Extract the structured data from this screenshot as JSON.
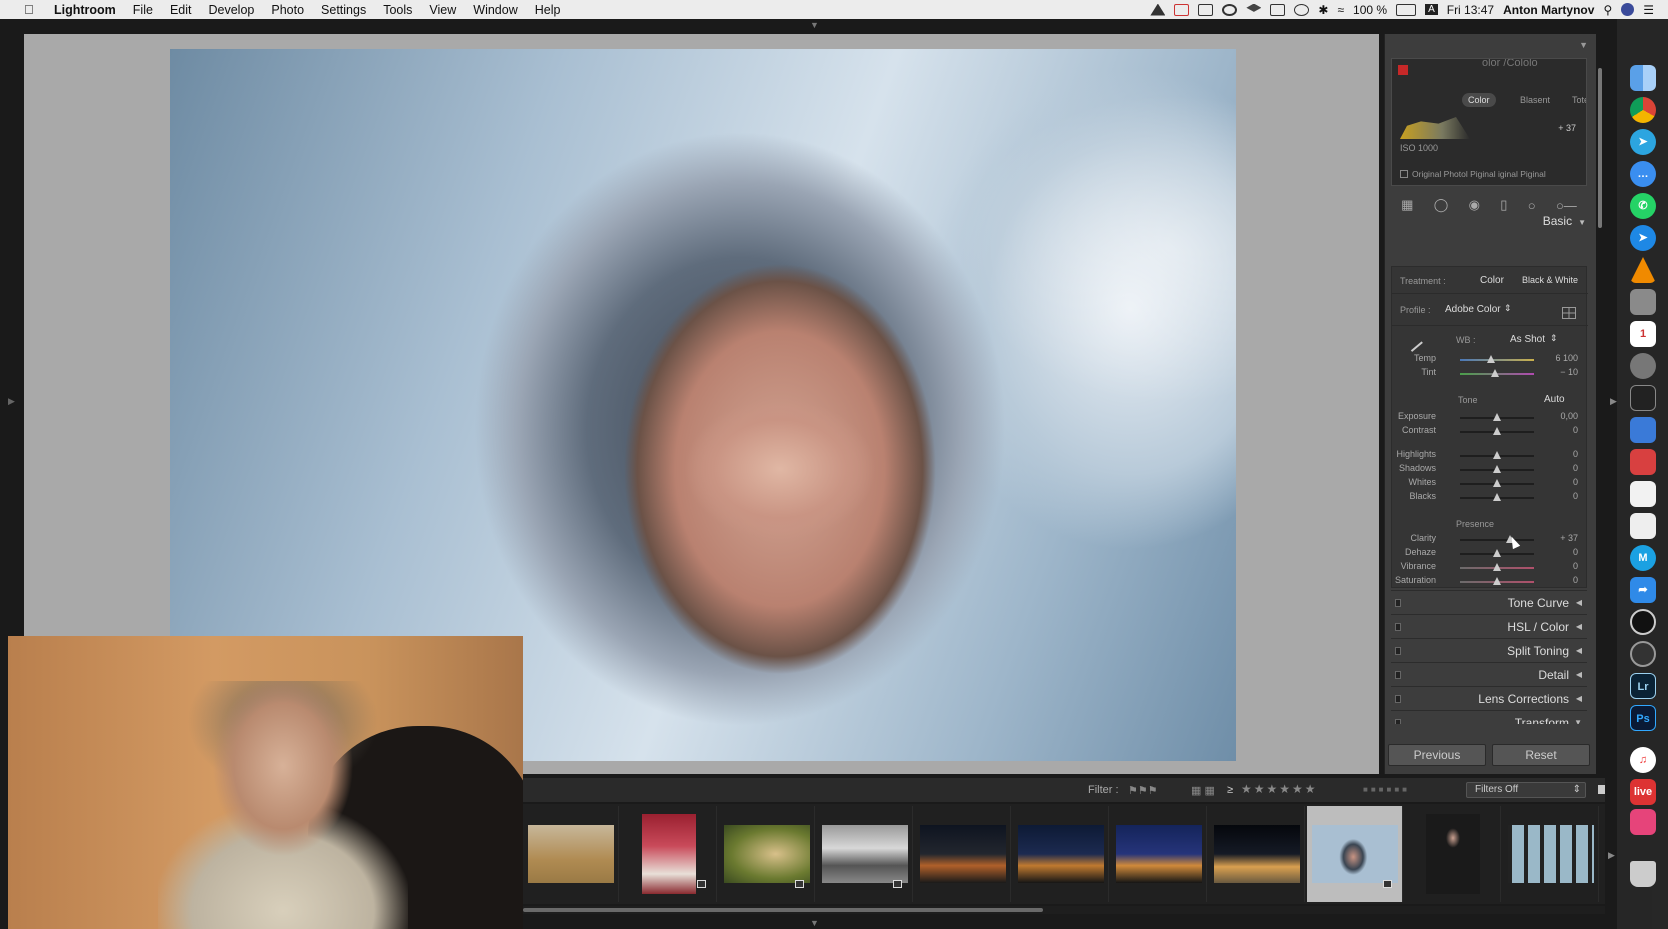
{
  "menubar": {
    "apple": "",
    "items": [
      "Lightroom",
      "File",
      "Edit",
      "Develop",
      "Photo",
      "Settings",
      "Tools",
      "View",
      "Window",
      "Help"
    ],
    "battery": "100 %",
    "clock": "Fri 13:47",
    "user": "Anton Martynov"
  },
  "histogram": {
    "faint_title": "olor   /Cololo",
    "tab_color": "Color",
    "tab_blasent": "Blasent",
    "tab_tote": "Tote",
    "iso": "ISO 1000",
    "value": "+ 37",
    "original_photo": "Original Photol Piginal iginal Piginal"
  },
  "basic": {
    "title": "Basic",
    "treatment_label": "Treatment :",
    "treatment_color": "Color",
    "treatment_bw": "Black & White",
    "profile_label": "Profile :",
    "profile_value": "Adobe Color",
    "wb_label": "WB :",
    "wb_value": "As Shot",
    "tone_label": "Tone",
    "auto": "Auto",
    "presence_label": "Presence",
    "sliders": [
      {
        "label": "Temp",
        "value": "6 100",
        "pos": 0.42
      },
      {
        "label": "Tint",
        "value": "− 10",
        "pos": 0.47
      },
      {
        "label": "Exposure",
        "value": "0,00",
        "pos": 0.5
      },
      {
        "label": "Contrast",
        "value": "0",
        "pos": 0.5
      },
      {
        "label": "Highlights",
        "value": "0",
        "pos": 0.5
      },
      {
        "label": "Shadows",
        "value": "0",
        "pos": 0.5
      },
      {
        "label": "Whites",
        "value": "0",
        "pos": 0.5
      },
      {
        "label": "Blacks",
        "value": "0",
        "pos": 0.5
      },
      {
        "label": "Clarity",
        "value": "+ 37",
        "pos": 0.68
      },
      {
        "label": "Dehaze",
        "value": "0",
        "pos": 0.5
      },
      {
        "label": "Vibrance",
        "value": "0",
        "pos": 0.5
      },
      {
        "label": "Saturation",
        "value": "0",
        "pos": 0.5
      }
    ]
  },
  "sections": [
    "Tone Curve",
    "HSL / Color",
    "Split Toning",
    "Detail",
    "Lens Corrections",
    "Transform"
  ],
  "buttons": {
    "previous": "Previous",
    "reset": "Reset"
  },
  "filmstrip": {
    "filter_label": "Filter :",
    "rating_op": "≥",
    "filters_off": "Filters Off"
  },
  "colors": {
    "panel": "#3d3d3d",
    "accent": "#e0e0e0"
  }
}
